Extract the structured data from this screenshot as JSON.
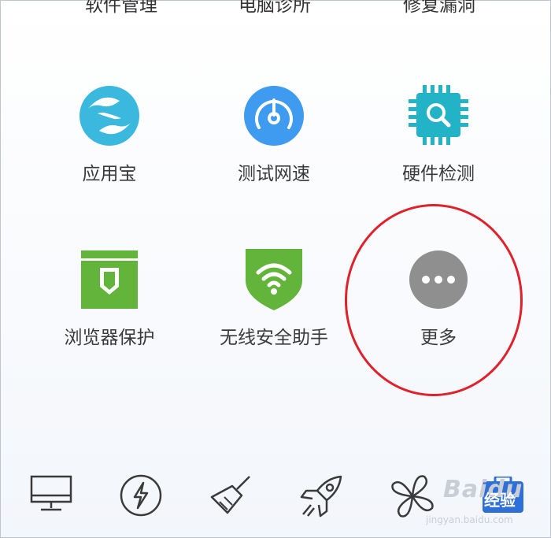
{
  "top_row": [
    "软件管理",
    "电脑诊所",
    "修复漏洞"
  ],
  "tools": [
    {
      "label": "应用宝",
      "icon": "yingyongbao-icon",
      "color": "#3bb8de"
    },
    {
      "label": "测试网速",
      "icon": "speed-test-icon",
      "color": "#3f9bf0"
    },
    {
      "label": "硬件检测",
      "icon": "hardware-chip-icon",
      "color": "#23b3c7"
    },
    {
      "label": "浏览器保护",
      "icon": "browser-shield-icon",
      "color": "#62b53a"
    },
    {
      "label": "无线安全助手",
      "icon": "wifi-shield-icon",
      "color": "#62b53a"
    },
    {
      "label": "更多",
      "icon": "more-dots-icon",
      "color": "#8f8f8f"
    }
  ],
  "bottom_bar": [
    "monitor-icon",
    "lightning-icon",
    "broom-icon",
    "rocket-icon",
    "fan-icon",
    "toolbox-icon"
  ],
  "watermark": {
    "brand": "Baidu",
    "label": "经验",
    "url": "jingyan.baidu.com"
  },
  "highlight_color": "#e0212b"
}
